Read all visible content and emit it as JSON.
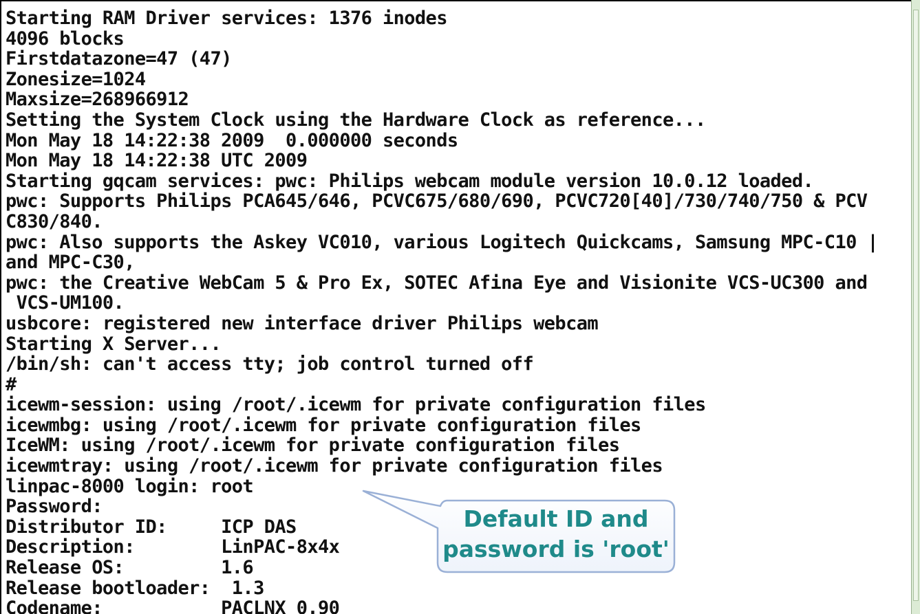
{
  "console": {
    "lines": [
      "Starting RAM Driver services: 1376 inodes",
      "4096 blocks",
      "Firstdatazone=47 (47)",
      "Zonesize=1024",
      "Maxsize=268966912",
      "Setting the System Clock using the Hardware Clock as reference...",
      "Mon May 18 14:22:38 2009  0.000000 seconds",
      "Mon May 18 14:22:38 UTC 2009",
      "Starting gqcam services: pwc: Philips webcam module version 10.0.12 loaded.",
      "pwc: Supports Philips PCA645/646, PCVC675/680/690, PCVC720[40]/730/740/750 & PCV",
      "C830/840.",
      "pwc: Also supports the Askey VC010, various Logitech Quickcams, Samsung MPC-C10 |",
      "and MPC-C30,",
      "pwc: the Creative WebCam 5 & Pro Ex, SOTEC Afina Eye and Visionite VCS-UC300 and",
      " VCS-UM100.",
      "usbcore: registered new interface driver Philips webcam",
      "Starting X Server...",
      "/bin/sh: can't access tty; job control turned off",
      "#",
      "icewm-session: using /root/.icewm for private configuration files",
      "icewmbg: using /root/.icewm for private configuration files",
      "IceWM: using /root/.icewm for private configuration files",
      "icewmtray: using /root/.icewm for private configuration files",
      "linpac-8000 login: root",
      "Password:",
      "Distributor ID:     ICP DAS",
      "Description:        LinPAC-8x4x",
      "Release OS:         1.6",
      "Release bootloader:  1.3",
      "Codename:           PACLNX 0.90"
    ]
  },
  "callout": {
    "line1": "Default ID and",
    "line2": "password is 'root'",
    "text_color": "#1f8a8a",
    "border_color": "#9ab0d6"
  },
  "colors": {
    "console_bg": "#ffffff",
    "console_text": "#111111",
    "scrollbar_bg": "#dcebd5"
  }
}
